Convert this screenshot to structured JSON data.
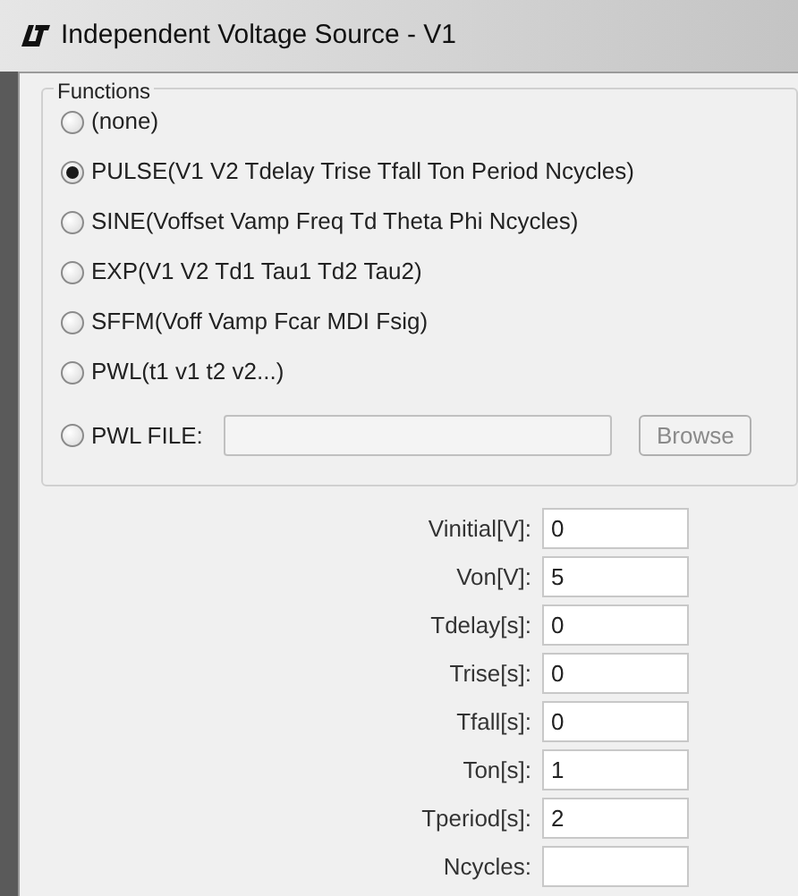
{
  "window": {
    "title": "Independent Voltage Source - V1"
  },
  "functions": {
    "legend": "Functions",
    "options": [
      {
        "label": "(none)",
        "selected": false
      },
      {
        "label": "PULSE(V1 V2 Tdelay Trise Tfall Ton Period Ncycles)",
        "selected": true
      },
      {
        "label": "SINE(Voffset Vamp Freq Td Theta Phi Ncycles)",
        "selected": false
      },
      {
        "label": "EXP(V1 V2 Td1 Tau1 Td2 Tau2)",
        "selected": false
      },
      {
        "label": "SFFM(Voff Vamp Fcar MDI Fsig)",
        "selected": false
      },
      {
        "label": "PWL(t1 v1 t2 v2...)",
        "selected": false
      },
      {
        "label": "PWL FILE:",
        "selected": false
      }
    ],
    "browse_button": "Browse"
  },
  "parameters": [
    {
      "label": "Vinitial[V]:",
      "value": "0"
    },
    {
      "label": "Von[V]:",
      "value": "5"
    },
    {
      "label": "Tdelay[s]:",
      "value": "0"
    },
    {
      "label": "Trise[s]:",
      "value": "0"
    },
    {
      "label": "Tfall[s]:",
      "value": "0"
    },
    {
      "label": "Ton[s]:",
      "value": "1"
    },
    {
      "label": "Tperiod[s]:",
      "value": "2"
    },
    {
      "label": "Ncycles:"
    }
  ]
}
